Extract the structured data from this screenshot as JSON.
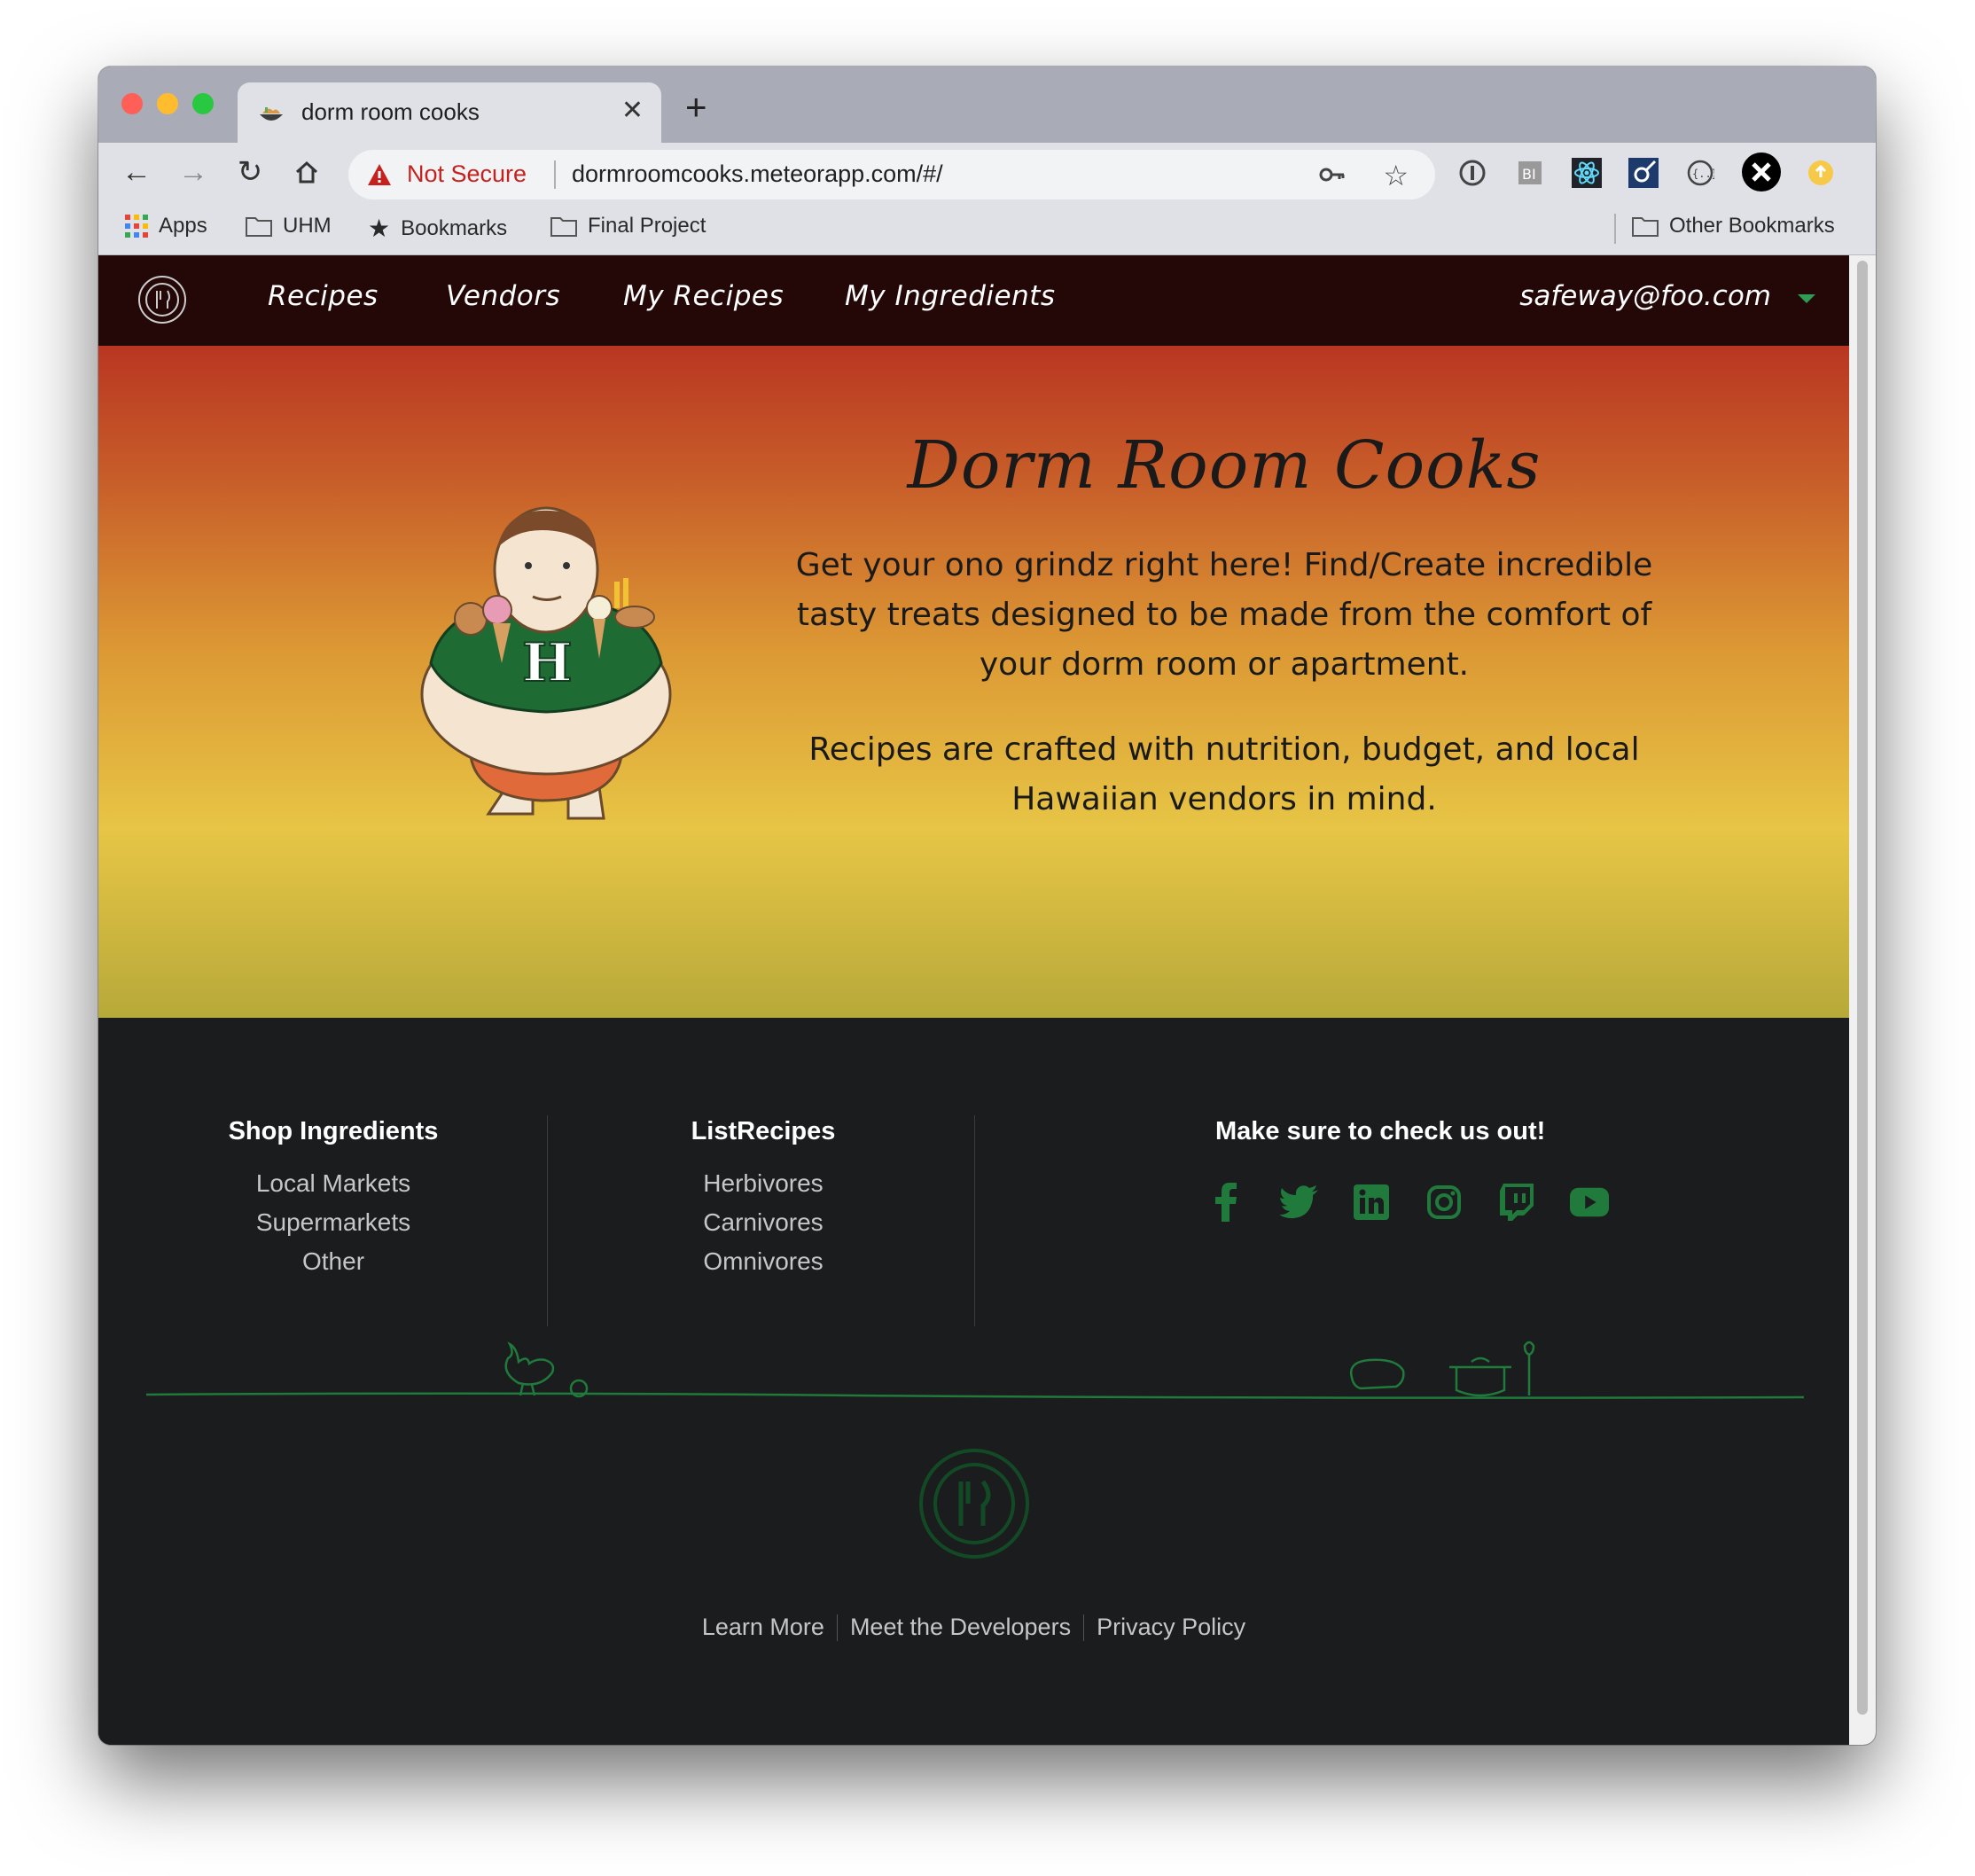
{
  "browser": {
    "tab_title": "dorm room cooks",
    "security_label": "Not Secure",
    "url": "dormroomcooks.meteorapp.com/#/",
    "bookmarks": [
      "Apps",
      "UHM",
      "Bookmarks",
      "Final Project"
    ],
    "other_bookmarks": "Other Bookmarks"
  },
  "navbar": {
    "items": [
      "Recipes",
      "Vendors",
      "My Recipes",
      "My Ingredients"
    ],
    "user": "safeway@foo.com"
  },
  "hero": {
    "title": "Dorm Room Cooks",
    "paragraph1": "Get your ono grindz right here! Find/Create incredible tasty treats designed to be made from the comfort of your dorm room or apartment.",
    "paragraph2": "Recipes are crafted with nutrition, budget, and local Hawaiian vendors in mind."
  },
  "footer": {
    "col1": {
      "heading": "Shop Ingredients",
      "links": [
        "Local Markets",
        "Supermarkets",
        "Other"
      ]
    },
    "col2": {
      "heading": "ListRecipes",
      "links": [
        "Herbivores",
        "Carnivores",
        "Omnivores"
      ]
    },
    "col3": {
      "heading": "Make sure to check us out!"
    },
    "social_icons": [
      "facebook-icon",
      "twitter-icon",
      "linkedin-icon",
      "instagram-icon",
      "twitch-icon",
      "youtube-icon"
    ],
    "bottom_links": [
      "Learn More",
      "Meet the Developers",
      "Privacy Policy"
    ]
  },
  "colors": {
    "navbar_bg": "#240808",
    "footer_bg": "#1b1c1d",
    "accent_green": "#1f7a3c",
    "not_secure_red": "#c5221f"
  }
}
